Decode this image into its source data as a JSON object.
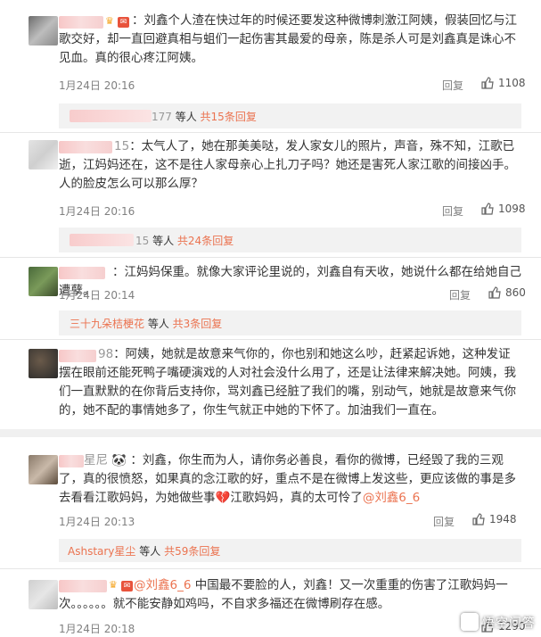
{
  "comments": [
    {
      "user_suffix": "",
      "text": "：刘鑫个人渣在快过年的时候还要发这种微博刺激江阿姨，假装回忆与江歌交好，却一直回避真相与蛆们一起伤害其最爱的母亲，陈是杀人可是刘鑫真是诛心不见血。真的很心疼江阿姨。",
      "time": "1月24日 20:16",
      "reply_label": "回复",
      "likes": "1108",
      "replies": {
        "user_suffix": "177",
        "text": " 等人 ",
        "link": "共15条回复"
      }
    },
    {
      "user_suffix": "15",
      "text": "：太气人了，她在那美美哒，发人家女儿的照片，声音，殊不知，江歌已逝，江妈妈还在，这不是往人家母亲心上扎刀子吗？她还是害死人家江歌的间接凶手。人的脸皮怎么可以那么厚？",
      "time": "1月24日 20:16",
      "reply_label": "回复",
      "likes": "1098",
      "replies": {
        "user_suffix": "15",
        "text": " 等人 ",
        "link": "共24条回复"
      }
    },
    {
      "user_suffix": "",
      "text": "：江妈妈保重。就像大家评论里说的，刘鑫自有天收，她说什么都在给她自己遭孽。",
      "time": "1月24日 20:14",
      "reply_label": "回复",
      "likes": "860",
      "replies": {
        "user_suffix": "三十九朵桔梗花",
        "text": " 等人 ",
        "link": "共3条回复"
      }
    },
    {
      "user_suffix": "98",
      "text": "：阿姨，她就是故意来气你的，你也别和她这么吵，赶紧起诉她，这种发证摆在眼前还能死鸭子嘴硬演戏的人对社会没什么用了，还是让法律来解决她。阿姨，我们一直默默的在你背后支持你，骂刘鑫已经脏了我们的嘴，别动气，她就是故意来气你的，她不配的事情她多了，你生气就正中她的下怀了。加油我们一直在。"
    },
    {
      "user_suffix": "星尼",
      "text_before": "：刘鑫，你生而为人，请你务必善良，看你的微博，已经毁了我的三观了，真的很愤怒，如果真的念江歌的好，重点不是在微博上发这些，更应该做的事是多去看看江歌妈妈，为她做些事",
      "text_heart": "💔",
      "text_middle": "江歌妈妈，真的太可怜了",
      "mention": "@刘鑫6_6",
      "time": "1月24日 20:13",
      "reply_label": "回复",
      "likes": "1948",
      "replies": {
        "user_suffix": "Ashstary星尘",
        "text": " 等人 ",
        "link": "共59条回复"
      }
    },
    {
      "user_suffix": "",
      "mention": "@刘鑫6_6",
      "text": " 中国最不要脸的人，刘鑫！又一次重重的伤害了江歌妈妈一次。。。。。。就不能安静如鸡吗，不自求多福还在微博刷存在感。",
      "time": "1月24日 20:18",
      "likes": "1290"
    }
  ],
  "watermark": "悟空问答",
  "colors": {
    "accent": "#eb7350",
    "muted": "#808080",
    "reply_bg": "#f2f2f2"
  }
}
